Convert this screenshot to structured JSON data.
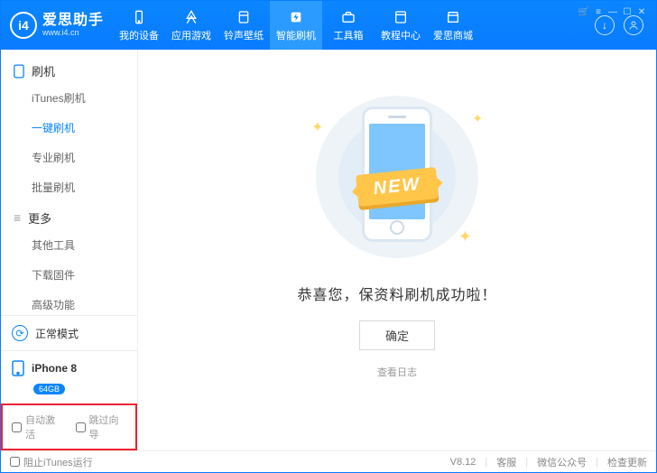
{
  "brand": {
    "name": "爱思助手",
    "site": "www.i4.cn",
    "logo_letters": "i4"
  },
  "title_icons": {
    "cart": "cart-icon",
    "list": "list-icon",
    "min": "min-icon",
    "max": "max-icon",
    "close": "close-icon"
  },
  "nav": [
    {
      "label": "我的设备",
      "icon": "phone-icon"
    },
    {
      "label": "应用游戏",
      "icon": "apps-icon"
    },
    {
      "label": "铃声壁纸",
      "icon": "music-icon"
    },
    {
      "label": "智能刷机",
      "icon": "flash-icon",
      "active": true
    },
    {
      "label": "工具箱",
      "icon": "toolbox-icon"
    },
    {
      "label": "教程中心",
      "icon": "book-icon"
    },
    {
      "label": "爱思商城",
      "icon": "store-icon"
    }
  ],
  "header_right": {
    "download": "↓",
    "user": "user-icon"
  },
  "sidebar": {
    "groups": [
      {
        "title": "刷机",
        "icon": "phone-outline-icon",
        "items": [
          {
            "label": "iTunes刷机"
          },
          {
            "label": "一键刷机",
            "active": true
          },
          {
            "label": "专业刷机"
          },
          {
            "label": "批量刷机"
          }
        ]
      },
      {
        "title": "更多",
        "icon": "more-icon",
        "items": [
          {
            "label": "其他工具"
          },
          {
            "label": "下载固件"
          },
          {
            "label": "高级功能"
          }
        ]
      }
    ],
    "mode": {
      "label": "正常模式"
    },
    "device": {
      "name": "iPhone 8",
      "storage": "64GB"
    },
    "checks": [
      {
        "label": "自动激活",
        "checked": false
      },
      {
        "label": "跳过向导",
        "checked": false
      }
    ]
  },
  "main": {
    "ribbon": "NEW",
    "message": "恭喜您，保资料刷机成功啦！",
    "ok": "确定",
    "log": "查看日志"
  },
  "footer": {
    "block_itunes": "阻止iTunes运行",
    "version": "V8.12",
    "links": [
      "客服",
      "微信公众号",
      "检查更新"
    ]
  }
}
